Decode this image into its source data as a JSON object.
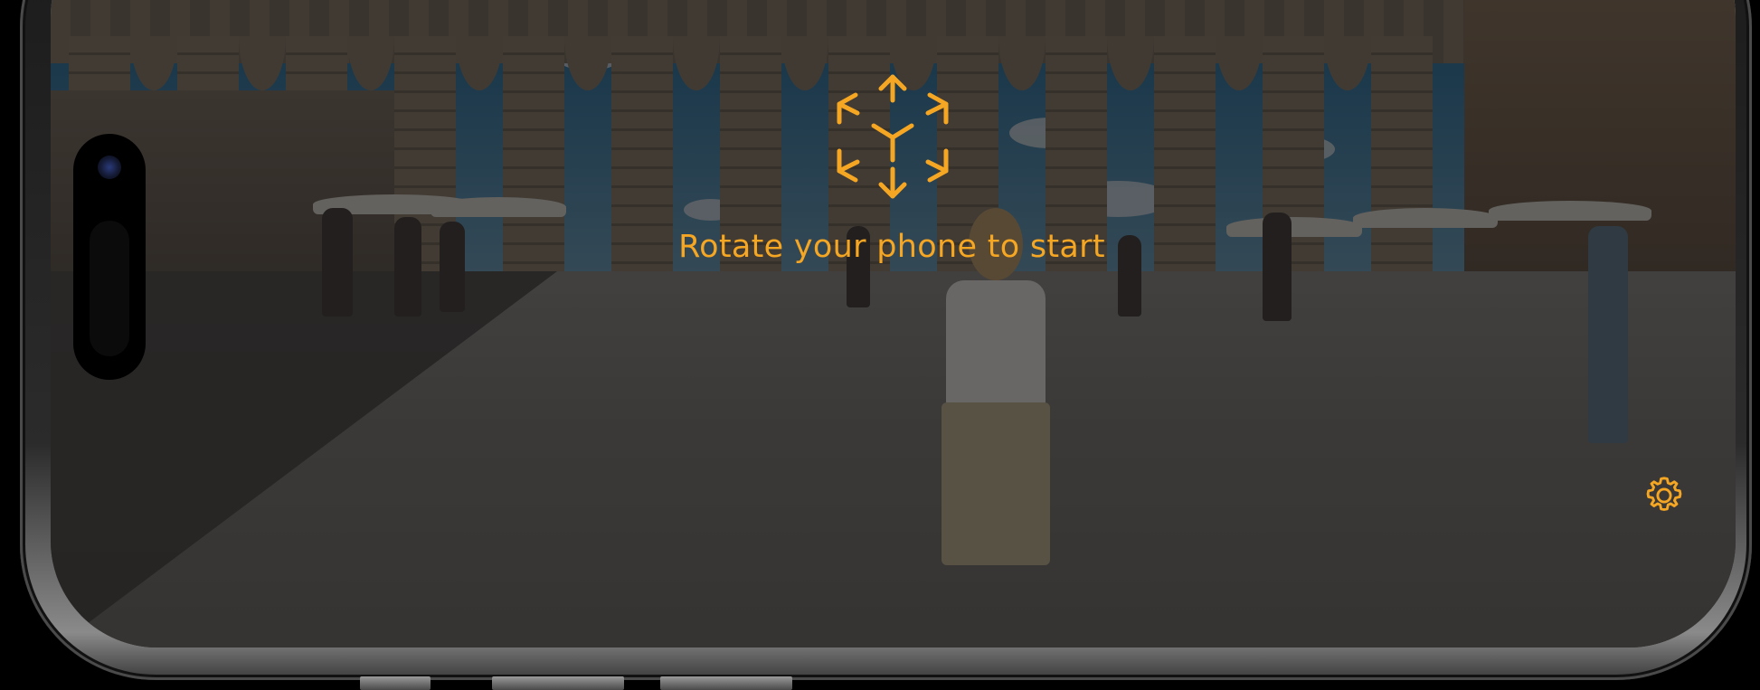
{
  "overlay": {
    "rotate_message": "Rotate your phone to start",
    "accent_color": "#f5a623",
    "dim_overlay": "rgba(20,20,20,0.62)"
  },
  "icons": {
    "rotate": "rotate-3d-cube-icon",
    "settings": "gear-icon"
  },
  "background": {
    "scene": "aqueduct-plaza-camera-view"
  }
}
